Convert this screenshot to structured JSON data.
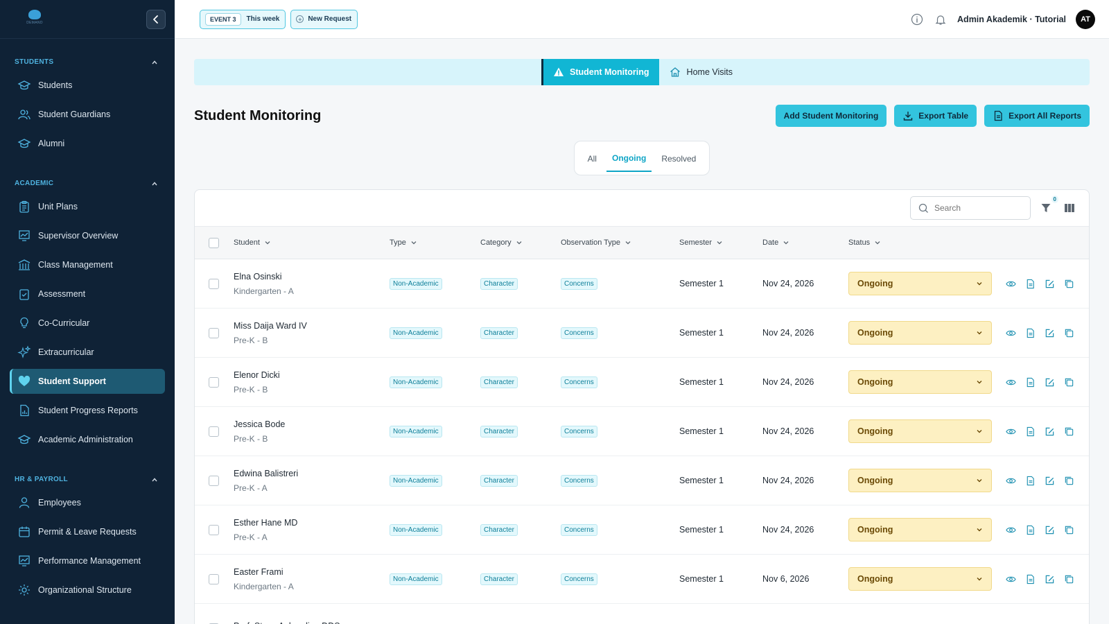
{
  "sidebar": {
    "logo_text": "DEMAND",
    "sections": [
      {
        "title": "STUDENTS",
        "items": [
          {
            "label": "Students",
            "icon": "graduation-cap-icon"
          },
          {
            "label": "Student Guardians",
            "icon": "users-icon"
          },
          {
            "label": "Alumni",
            "icon": "graduation-cap-icon"
          }
        ]
      },
      {
        "title": "ACADEMIC",
        "items": [
          {
            "label": "Unit Plans",
            "icon": "clipboard-icon"
          },
          {
            "label": "Supervisor Overview",
            "icon": "chart-icon"
          },
          {
            "label": "Class Management",
            "icon": "building-icon"
          },
          {
            "label": "Assessment",
            "icon": "clipboard-check-icon"
          },
          {
            "label": "Co-Curricular",
            "icon": "lightbulb-icon"
          },
          {
            "label": "Extracurricular",
            "icon": "sparkles-icon"
          },
          {
            "label": "Student Support",
            "icon": "heart-icon",
            "active": true
          },
          {
            "label": "Student Progress Reports",
            "icon": "document-chart-icon"
          },
          {
            "label": "Academic Administration",
            "icon": "graduation-cap-icon"
          }
        ]
      },
      {
        "title": "HR & PAYROLL",
        "items": [
          {
            "label": "Employees",
            "icon": "user-icon"
          },
          {
            "label": "Permit & Leave Requests",
            "icon": "calendar-icon"
          },
          {
            "label": "Performance Management",
            "icon": "chart-icon"
          },
          {
            "label": "Organizational Structure",
            "icon": "gear-icon"
          }
        ]
      }
    ]
  },
  "topbar": {
    "event_tag": "EVENT 3",
    "event_label": "This week",
    "new_request": "New Request",
    "user": "Admin Akademik · Tutorial",
    "avatar_initials": "AT"
  },
  "module_tabs": [
    {
      "label": "Student Monitoring",
      "icon": "warning-icon",
      "active": true
    },
    {
      "label": "Home Visits",
      "icon": "home-icon",
      "active": false
    }
  ],
  "page": {
    "title": "Student Monitoring",
    "actions": {
      "add": "Add Student Monitoring",
      "export_table": "Export Table",
      "export_all": "Export All Reports"
    }
  },
  "status_tabs": [
    {
      "label": "All",
      "active": false
    },
    {
      "label": "Ongoing",
      "active": true
    },
    {
      "label": "Resolved",
      "active": false
    }
  ],
  "table": {
    "search_placeholder": "Search",
    "filter_count": "0",
    "columns": [
      "Student",
      "Type",
      "Category",
      "Observation Type",
      "Semester",
      "Date",
      "Status"
    ],
    "rows": [
      {
        "name": "Elna Osinski",
        "class": "Kindergarten - A",
        "type": "Non-Academic",
        "category": "Character",
        "observation": "Concerns",
        "semester": "Semester 1",
        "date": "Nov 24, 2026",
        "status": "Ongoing"
      },
      {
        "name": "Miss Daija Ward IV",
        "class": "Pre-K - B",
        "type": "Non-Academic",
        "category": "Character",
        "observation": "Concerns",
        "semester": "Semester 1",
        "date": "Nov 24, 2026",
        "status": "Ongoing"
      },
      {
        "name": "Elenor Dicki",
        "class": "Pre-K - B",
        "type": "Non-Academic",
        "category": "Character",
        "observation": "Concerns",
        "semester": "Semester 1",
        "date": "Nov 24, 2026",
        "status": "Ongoing"
      },
      {
        "name": "Jessica Bode",
        "class": "Pre-K - B",
        "type": "Non-Academic",
        "category": "Character",
        "observation": "Concerns",
        "semester": "Semester 1",
        "date": "Nov 24, 2026",
        "status": "Ongoing"
      },
      {
        "name": "Edwina Balistreri",
        "class": "Pre-K - A",
        "type": "Non-Academic",
        "category": "Character",
        "observation": "Concerns",
        "semester": "Semester 1",
        "date": "Nov 24, 2026",
        "status": "Ongoing"
      },
      {
        "name": "Esther Hane MD",
        "class": "Pre-K - A",
        "type": "Non-Academic",
        "category": "Character",
        "observation": "Concerns",
        "semester": "Semester 1",
        "date": "Nov 24, 2026",
        "status": "Ongoing"
      },
      {
        "name": "Easter Frami",
        "class": "Kindergarten - A",
        "type": "Non-Academic",
        "category": "Character",
        "observation": "Concerns",
        "semester": "Semester 1",
        "date": "Nov 6, 2026",
        "status": "Ongoing"
      },
      {
        "name": "Prof. Steve Ankunding DDS",
        "class": "",
        "type": "",
        "category": "",
        "observation": "",
        "semester": "",
        "date": "",
        "status": ""
      }
    ]
  }
}
